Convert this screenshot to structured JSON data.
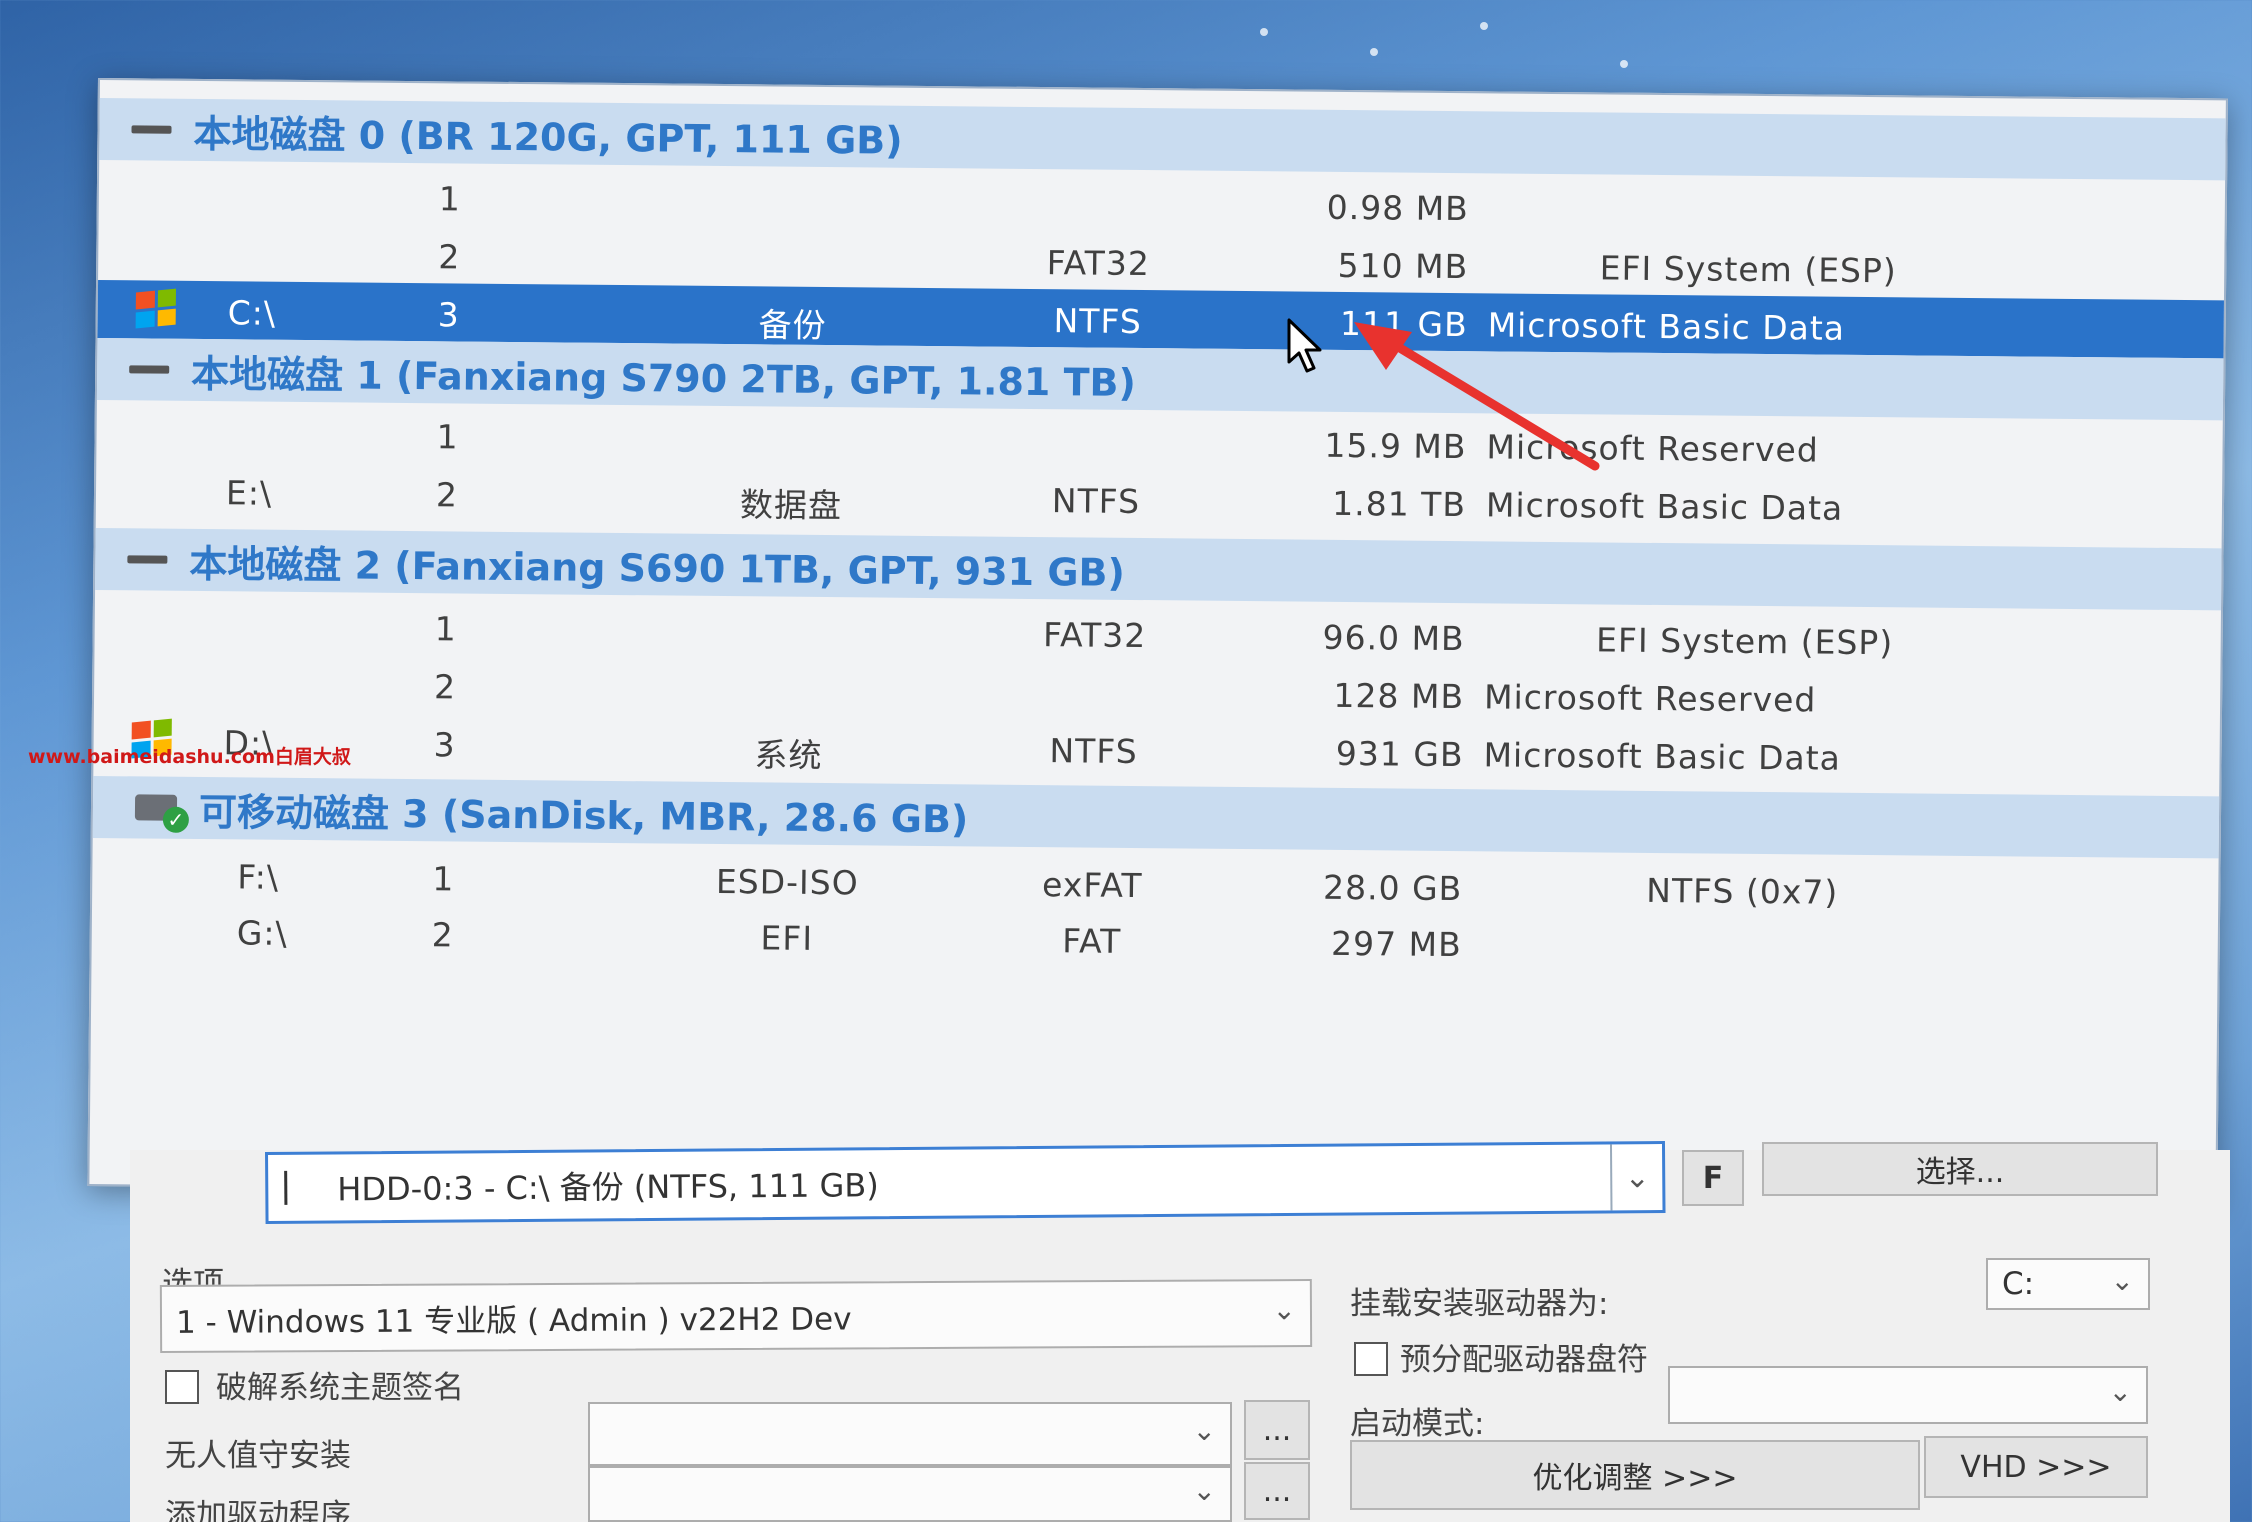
{
  "disks": [
    {
      "title": "本地磁盘 0 (BR 120G, GPT, 111 GB)",
      "partitions": [
        {
          "drive": "",
          "number": "1",
          "label": "",
          "fs": "",
          "size": "0.98 MB",
          "type": ""
        },
        {
          "drive": "",
          "number": "2",
          "label": "",
          "fs": "FAT32",
          "size": "510 MB",
          "type": "EFI System (ESP)"
        },
        {
          "drive": "C:\\",
          "number": "3",
          "label": "备份",
          "fs": "NTFS",
          "size": "111 GB",
          "type": "Microsoft Basic Data"
        }
      ]
    },
    {
      "title": "本地磁盘 1 (Fanxiang S790 2TB, GPT, 1.81 TB)",
      "partitions": [
        {
          "drive": "",
          "number": "1",
          "label": "",
          "fs": "",
          "size": "15.9 MB",
          "type": "Microsoft Reserved"
        },
        {
          "drive": "E:\\",
          "number": "2",
          "label": "数据盘",
          "fs": "NTFS",
          "size": "1.81 TB",
          "type": "Microsoft Basic Data"
        }
      ]
    },
    {
      "title": "本地磁盘 2 (Fanxiang S690 1TB, GPT, 931 GB)",
      "partitions": [
        {
          "drive": "",
          "number": "1",
          "label": "",
          "fs": "FAT32",
          "size": "96.0 MB",
          "type": "EFI System (ESP)"
        },
        {
          "drive": "",
          "number": "2",
          "label": "",
          "fs": "",
          "size": "128 MB",
          "type": "Microsoft Reserved"
        },
        {
          "drive": "D:\\",
          "number": "3",
          "label": "系统",
          "fs": "NTFS",
          "size": "931 GB",
          "type": "Microsoft Basic Data"
        }
      ]
    },
    {
      "title": "可移动磁盘 3 (SanDisk, MBR, 28.6 GB)",
      "partitions": [
        {
          "drive": "F:\\",
          "number": "1",
          "label": "ESD-ISO",
          "fs": "exFAT",
          "size": "28.0 GB",
          "type": "NTFS (0x7)"
        },
        {
          "drive": "G:\\",
          "number": "2",
          "label": "EFI",
          "fs": "FAT",
          "size": "297 MB",
          "type": ""
        }
      ]
    }
  ],
  "target": {
    "value": "HDD-0:3 - C:\\ 备份 (NTFS, 111 GB)",
    "f_button": "F",
    "select_button": "选择..."
  },
  "options": {
    "section_label": "选项",
    "edition": "1 - Windows 11 专业版 ( Admin )  v22H2 Dev",
    "crack_theme_label": "破解系统主题签名",
    "unattended_label": "无人值守安装",
    "add_driver_label": "添加驱动程序",
    "browse_label": "...",
    "mount_label": "挂载安装驱动器为:",
    "mount_value": "C:",
    "prealloc_label": "预分配驱动器盘符",
    "boot_mode_label": "启动模式:",
    "optimize_button": "优化调整 >>>",
    "vhd_button": "VHD >>>"
  },
  "watermark": "www.baimeidashu.com白眉大叔",
  "colors": {
    "header_bg": "#c9dcf0",
    "header_text": "#2f78c8",
    "selected_row": "#2a73c9",
    "annotation_arrow": "#e8322e"
  }
}
